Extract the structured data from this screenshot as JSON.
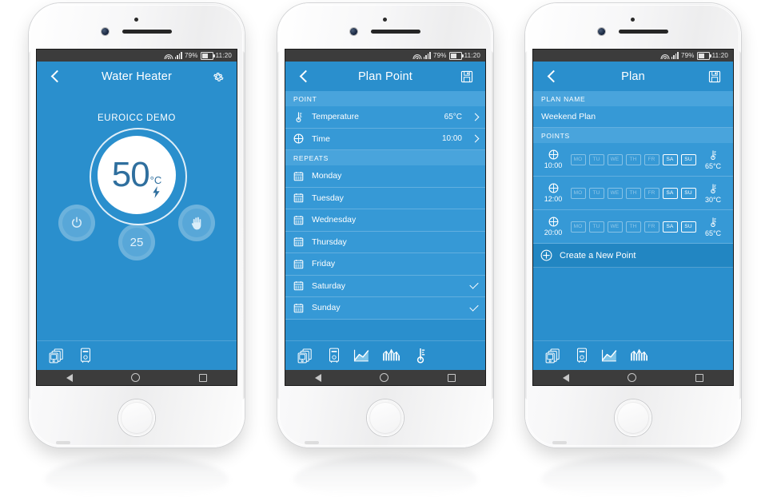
{
  "status_bar": {
    "battery_percent": "79%",
    "time": "11:20",
    "icons": [
      "wifi-icon",
      "signal-icon",
      "battery-icon"
    ]
  },
  "nav_bar": {
    "back": "back-triangle-icon",
    "home": "home-circle-icon",
    "recents": "recents-square-icon"
  },
  "colors": {
    "accent_blue": "#2a8fcd",
    "row_blue": "#3699d6",
    "section_blue": "#49a4dc",
    "dark_row_blue": "#2286c2",
    "status_bar": "#3c3c3c",
    "dial_text": "#2f6f9e"
  },
  "phone1": {
    "header": {
      "title": "Water Heater",
      "back_icon": "chevron-left-icon",
      "action_icon": "gear-icon"
    },
    "device_name": "EUROICC DEMO",
    "dial": {
      "temperature": "50",
      "unit": "°C",
      "bolt_icon": "lightning-bolt-icon"
    },
    "buttons": {
      "power": "power-icon",
      "manual": "hand-icon",
      "setpoint": "25"
    },
    "toolbar": [
      {
        "icon": "devices-icon",
        "label": "Devices"
      },
      {
        "icon": "boiler-icon",
        "label": "Boiler"
      }
    ]
  },
  "phone2": {
    "header": {
      "title": "Plan Point",
      "back_icon": "chevron-left-icon",
      "action_icon": "save-icon"
    },
    "sections": [
      {
        "label": "POINT",
        "rows": [
          {
            "icon": "thermometer-icon",
            "label": "Temperature",
            "value": "65°C",
            "chevron": true
          },
          {
            "icon": "clock-icon",
            "label": "Time",
            "value": "10:00",
            "chevron": true
          }
        ]
      },
      {
        "label": "REPEATS",
        "rows": [
          {
            "icon": "calendar-icon",
            "label": "Monday",
            "checked": false
          },
          {
            "icon": "calendar-icon",
            "label": "Tuesday",
            "checked": false
          },
          {
            "icon": "calendar-icon",
            "label": "Wednesday",
            "checked": false
          },
          {
            "icon": "calendar-icon",
            "label": "Thursday",
            "checked": false
          },
          {
            "icon": "calendar-icon",
            "label": "Friday",
            "checked": false
          },
          {
            "icon": "calendar-icon",
            "label": "Saturday",
            "checked": true
          },
          {
            "icon": "calendar-icon",
            "label": "Sunday",
            "checked": true
          }
        ]
      }
    ],
    "toolbar": [
      {
        "icon": "devices-icon",
        "label": "Devices"
      },
      {
        "icon": "boiler-icon",
        "label": "Boiler"
      },
      {
        "icon": "line-chart-icon",
        "label": "Graph"
      },
      {
        "icon": "bar-chart-icon",
        "label": "Statistics"
      },
      {
        "icon": "thermometer-icon",
        "label": "Temperature"
      }
    ]
  },
  "phone3": {
    "header": {
      "title": "Plan",
      "back_icon": "chevron-left-icon",
      "action_icon": "save-icon"
    },
    "plan_name_label": "PLAN NAME",
    "plan_name_value": "Weekend Plan",
    "points_label": "POINTS",
    "day_codes": [
      "MO",
      "TU",
      "WE",
      "TH",
      "FR",
      "SA",
      "SU"
    ],
    "points": [
      {
        "time": "10:00",
        "temp": "65°C",
        "active_days": [
          "SA",
          "SU"
        ],
        "clock_icon": "clock-icon",
        "temp_icon": "thermometer-icon"
      },
      {
        "time": "12:00",
        "temp": "30°C",
        "active_days": [
          "SA",
          "SU"
        ],
        "clock_icon": "clock-icon",
        "temp_icon": "thermometer-icon"
      },
      {
        "time": "20:00",
        "temp": "65°C",
        "active_days": [
          "SA",
          "SU"
        ],
        "clock_icon": "clock-icon",
        "temp_icon": "thermometer-icon"
      }
    ],
    "create_point": {
      "label": "Create a New Point",
      "icon": "plus-circle-icon",
      "chevron": "chevron-right-icon"
    },
    "toolbar": [
      {
        "icon": "devices-icon",
        "label": "Devices"
      },
      {
        "icon": "boiler-icon",
        "label": "Boiler"
      },
      {
        "icon": "line-chart-icon",
        "label": "Graph"
      },
      {
        "icon": "bar-chart-icon",
        "label": "Statistics"
      }
    ]
  }
}
